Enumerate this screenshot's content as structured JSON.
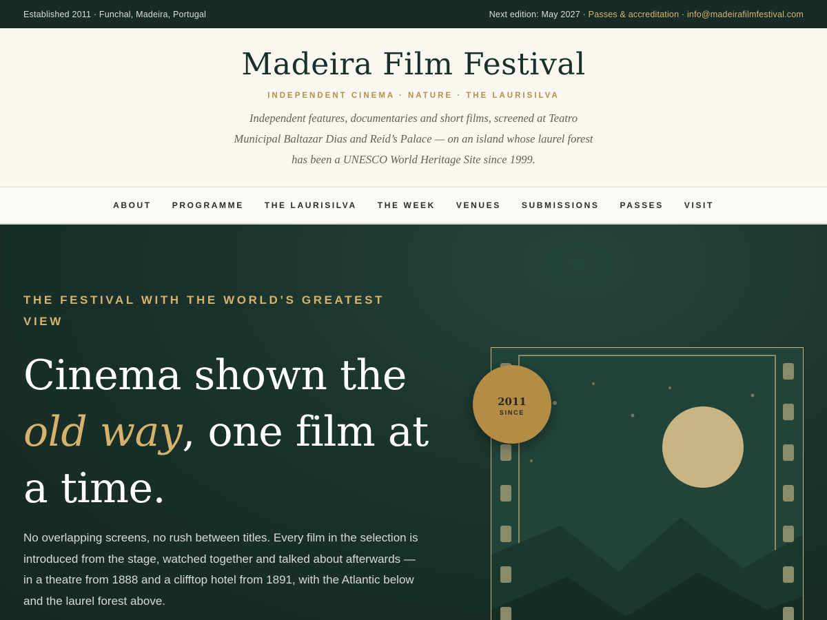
{
  "topbar": {
    "left": "Established 2011 · Funchal, Madeira, Portugal",
    "next_edition": "Next edition: May 2027 · ",
    "passes_link": "Passes & accreditation",
    "separator": " · ",
    "email_link": "info@madeirafilmfestival.com"
  },
  "masthead": {
    "title": "Madeira Film Festival",
    "tagline": "INDEPENDENT CINEMA · NATURE · THE LAURISILVA",
    "intro": "Independent features, documentaries and short films, screened at Teatro Municipal Baltazar Dias and Reid’s Palace — on an island whose laurel forest has been a UNESCO World Heritage Site since 1999."
  },
  "nav": {
    "items": [
      "ABOUT",
      "PROGRAMME",
      "THE LAURISILVA",
      "THE WEEK",
      "VENUES",
      "SUBMISSIONS",
      "PASSES",
      "VISIT"
    ]
  },
  "hero": {
    "eyebrow": "THE FESTIVAL WITH THE WORLD’S GREATEST VIEW",
    "headline_part1": "Cinema shown the ",
    "headline_em": "old way",
    "headline_part2": ", one film at a time.",
    "body": "No overlapping screens, no rush between titles. Every film in the selection is introduced from the stage, watched together and talked about afterwards — in a theatre from 1888 and a clifftop hotel from 1891, with the Atlantic below and the laurel forest above.",
    "badge_year": "2011",
    "badge_label": "SINCE"
  },
  "colors": {
    "dark_green": "#172c26",
    "gold": "#d6b36d",
    "cream": "#faf7f1"
  }
}
